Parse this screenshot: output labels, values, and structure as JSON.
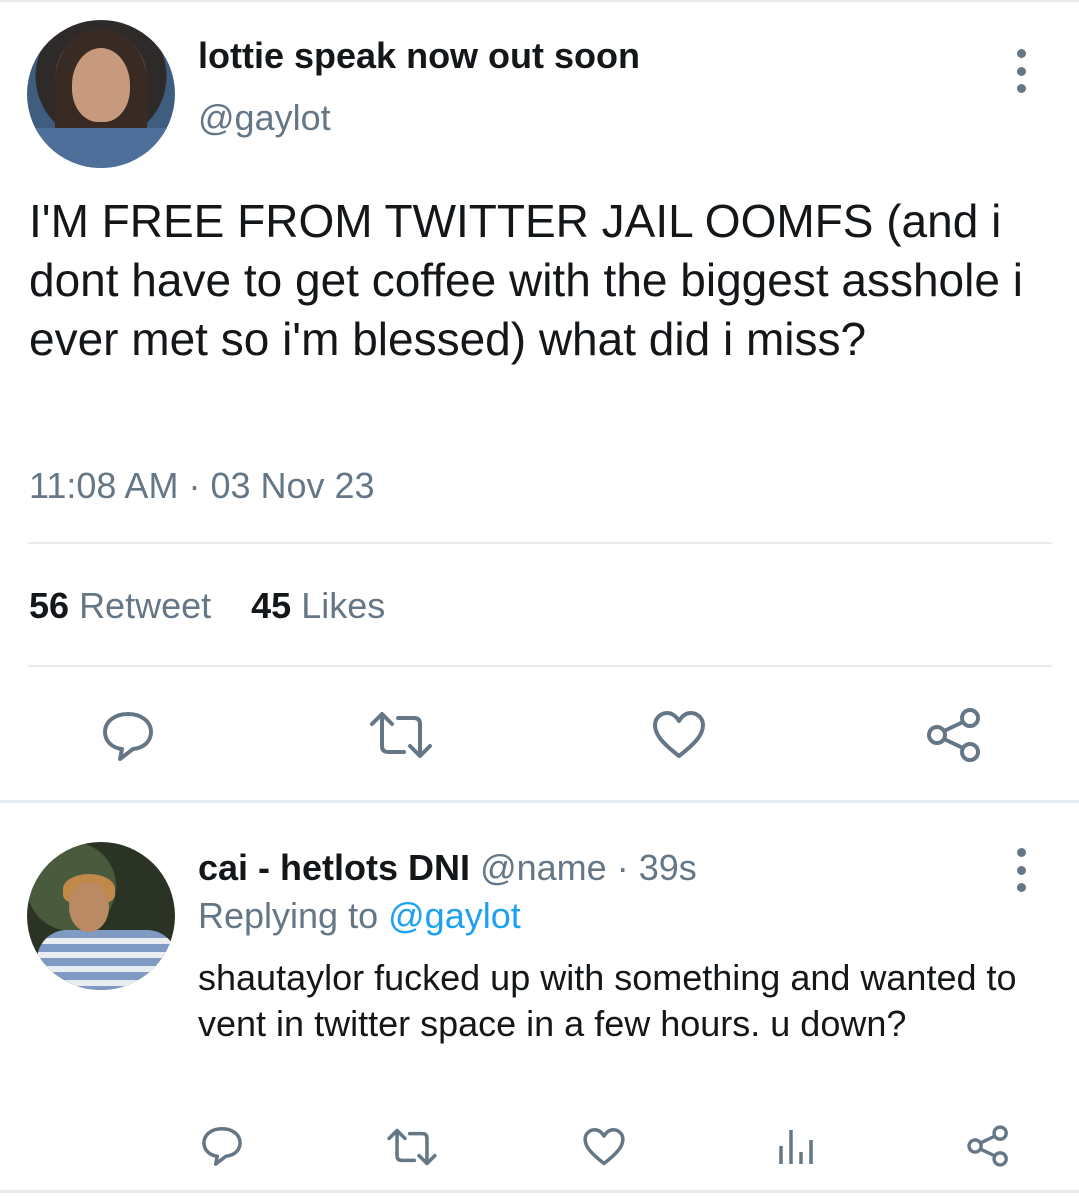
{
  "main_tweet": {
    "display_name": "lottie speak now out soon",
    "handle": "@gaylot",
    "text": "I'M FREE FROM TWITTER JAIL OOMFS (and i dont have to get coffee with the biggest asshole i ever met so i'm blessed) what did i miss?",
    "time": "11:08 AM",
    "date_separator": "·",
    "date": "03 Nov 23",
    "retweet_count": "56",
    "retweet_label": "Retweet",
    "like_count": "45",
    "like_label": "Likes",
    "avatar_alt": "profile photo"
  },
  "reply": {
    "display_name": "cai - hetlots DNI",
    "handle": "@name",
    "separator": "·",
    "time": "39s",
    "replying_to_label": "Replying to",
    "replying_to_handle": "@gaylot",
    "text": "shautaylor fucked up with something and wanted to vent in twitter space in a few hours. u down?"
  },
  "icons": {
    "main_actions": [
      "comment-icon",
      "retweet-icon",
      "heart-icon",
      "share-icon"
    ],
    "reply_actions": [
      "comment-icon",
      "retweet-icon",
      "heart-icon",
      "analytics-icon",
      "share-icon"
    ],
    "more": "more-vertical-icon"
  },
  "colors": {
    "text": "#14171a",
    "muted": "#657786",
    "link": "#1da1f2",
    "divider": "#e6ecf0"
  }
}
